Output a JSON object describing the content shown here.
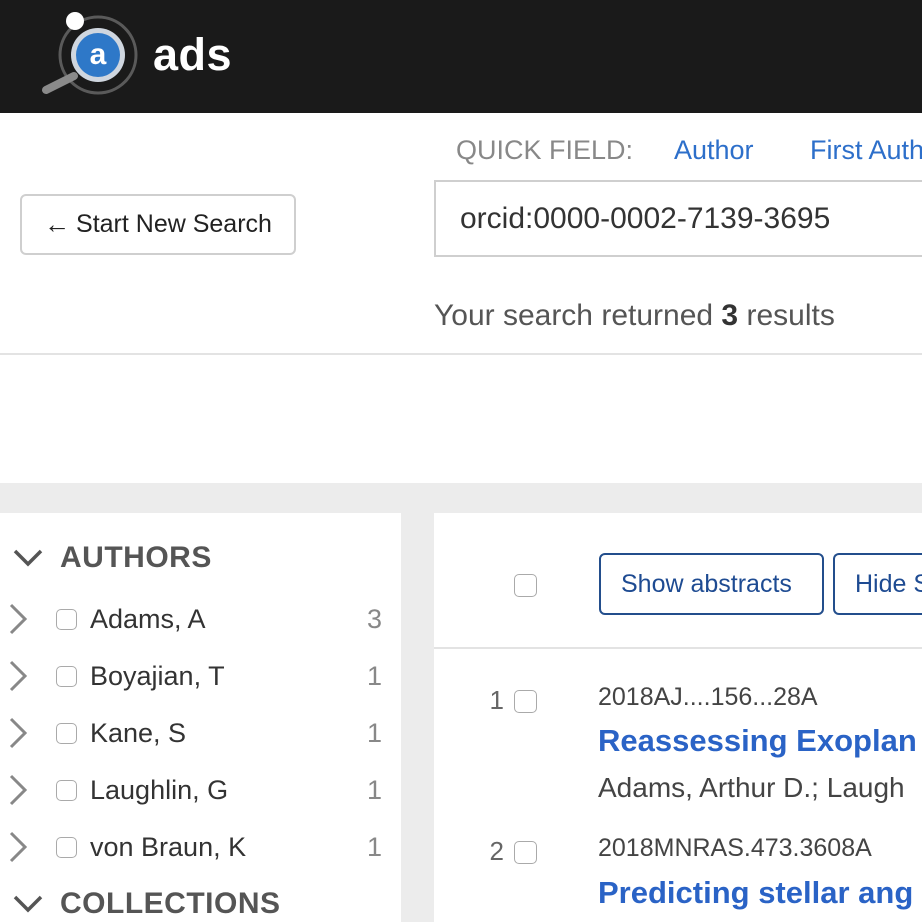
{
  "header": {
    "logo_text": "ads",
    "logo_letter": "a"
  },
  "search": {
    "start_new_search": "Start New Search",
    "quick_field_label": "QUICK FIELD:",
    "quick_fields": [
      "Author",
      "First Auth"
    ],
    "query": "orcid:0000-0002-7139-3695",
    "results_prefix": "Your search returned",
    "results_count": "3",
    "results_suffix": "results"
  },
  "facets": {
    "authors_heading": "AUTHORS",
    "authors": [
      {
        "name": "Adams, A",
        "count": "3"
      },
      {
        "name": "Boyajian, T",
        "count": "1"
      },
      {
        "name": "Kane, S",
        "count": "1"
      },
      {
        "name": "Laughlin, G",
        "count": "1"
      },
      {
        "name": "von Braun, K",
        "count": "1"
      }
    ],
    "collections_heading": "COLLECTIONS"
  },
  "toolbar": {
    "show_abstracts": "Show abstracts",
    "hide": "Hide S"
  },
  "results": [
    {
      "index": "1",
      "bibcode": "2018AJ....156...28A",
      "title": "Reassessing Exoplan",
      "authors": "Adams, Arthur D.;  Laugh"
    },
    {
      "index": "2",
      "bibcode": "2018MNRAS.473.3608A",
      "title": "Predicting stellar ang"
    }
  ],
  "colors": {
    "topbar": "#1a1a1a",
    "link": "#2d6fca",
    "title_link": "#2a63c6",
    "button_border": "#234e8c"
  }
}
